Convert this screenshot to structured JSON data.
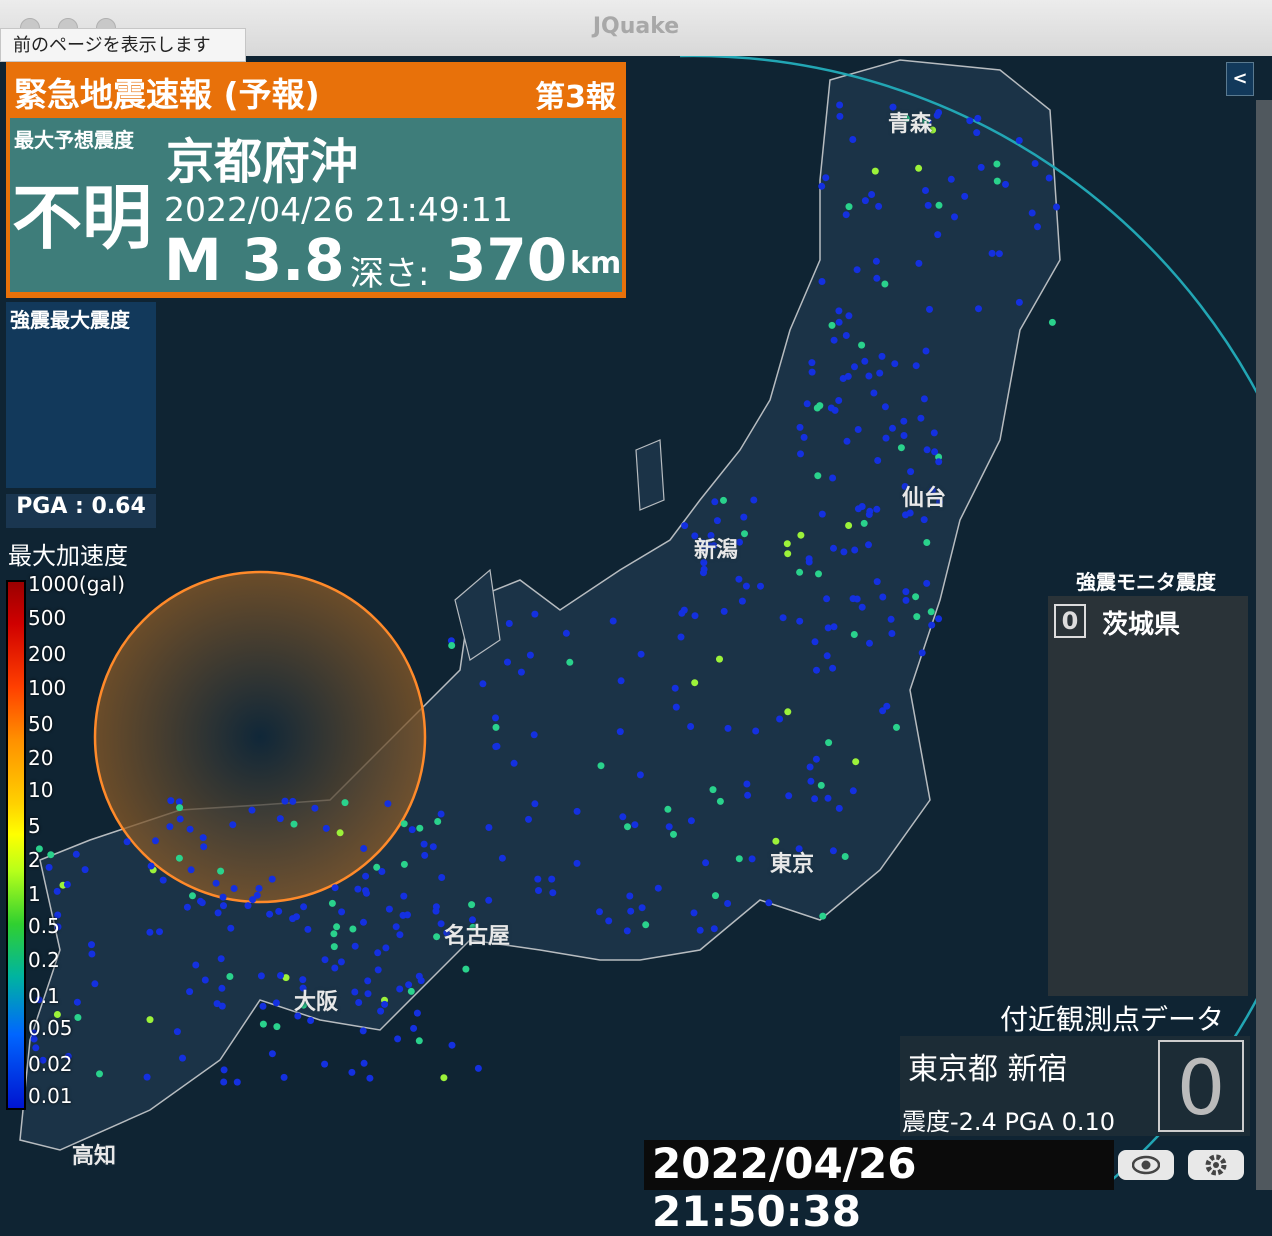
{
  "window": {
    "title": "JQuake",
    "tooltip": "前のページを表示します"
  },
  "eew": {
    "header": "緊急地震速報 (予報)",
    "report_number": "第3報",
    "max_intensity_label": "最大予想震度",
    "max_intensity_value": "不明",
    "region": "京都府沖",
    "time": "2022/04/26 21:49:11",
    "magnitude": "M 3.8",
    "depth_label": "深さ:",
    "depth_value": "370",
    "depth_unit": "km",
    "color": "#e8710a"
  },
  "strong_motion_max": {
    "label": "強震最大震度"
  },
  "pga": {
    "label": "PGA : 0.64"
  },
  "legend": {
    "title": "最大加速度",
    "labels": [
      "1000(gal)",
      "500",
      "200",
      "100",
      "50",
      "20",
      "10",
      "5",
      "2",
      "1",
      "0.5",
      "0.2",
      "0.1",
      "0.05",
      "0.02",
      "0.01"
    ]
  },
  "map_labels": {
    "aomori": "青森",
    "sendai": "仙台",
    "niigata": "新潟",
    "tokyo": "東京",
    "nagoya": "名古屋",
    "osaka": "大阪",
    "kochi": "高知"
  },
  "shindo_monitor": {
    "title": "強震モニタ震度",
    "badge": "0",
    "prefecture": "茨城県"
  },
  "nearby": {
    "title": "付近観測点データ",
    "place": "東京都 新宿",
    "stats": "震度-2.4  PGA  0.10",
    "intensity": "0"
  },
  "clock": "2022/04/26 21:50:38",
  "controls": {
    "collapse_label": "<",
    "icons": [
      "eye-icon",
      "gear-icon"
    ]
  }
}
